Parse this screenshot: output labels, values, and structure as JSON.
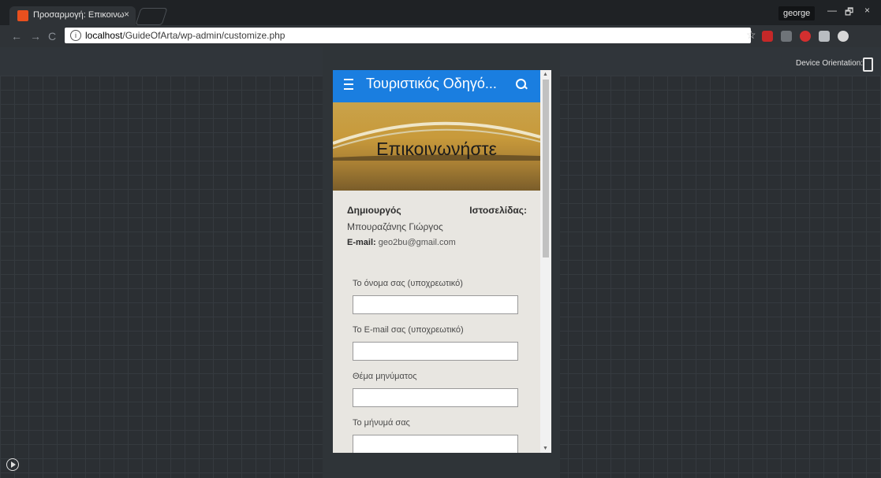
{
  "browser": {
    "tab_title": "Προσαρμογή: Επικοινω",
    "tab_close": "×",
    "user_name": "george",
    "url_host": "localhost",
    "url_path": "/GuideOfArta/wp-admin/customize.php",
    "info_icon": "i",
    "win_minimize": "—",
    "win_restore": "🗗",
    "win_close": "×",
    "back": "←",
    "forward": "→",
    "reload": "C",
    "star": "☆"
  },
  "customizer": {
    "device_orientation_label": "Device Orientation:"
  },
  "site": {
    "title": "Τουριστικός Οδηγό...",
    "hero_title": "Επικοινωνήστε",
    "creator_label": "Δημιουργός",
    "website_label": "Ιστοσελίδας:",
    "creator_name": "Μπουραζάνης Γιώργος",
    "email_label": "E-mail:",
    "email_value": "geo2bu@gmail.com",
    "form": {
      "name_label": "Το όνομα σας (υποχρεωτικό)",
      "email_label": "Το E-mail σας (υποχρεωτικό)",
      "subject_label": "Θέμα μηνύματος",
      "message_label": "Το μήνυμά σας"
    }
  },
  "colors": {
    "header": "#1a7ee0",
    "hero": "#c9a24a",
    "background": "#2b2f33"
  },
  "icons": [
    "favicon-icon",
    "close-icon",
    "info-icon",
    "star-icon",
    "menu-icon",
    "search-icon",
    "phone-icon",
    "play-icon",
    "scroll-up-icon",
    "scroll-down-icon"
  ]
}
